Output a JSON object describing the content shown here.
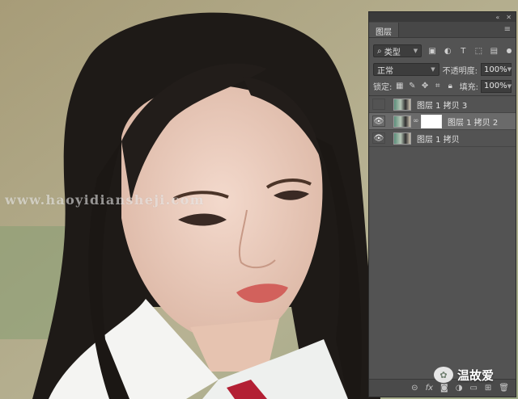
{
  "watermark": "www.haoyidiansheji.com",
  "panel": {
    "tab_label": "图层",
    "filter_kind": "类型",
    "blend_mode": "正常",
    "opacity_label": "不透明度:",
    "opacity_value": "100%",
    "lock_label": "锁定:",
    "fill_label": "填充:",
    "fill_value": "100%",
    "layers": [
      {
        "name": "图层 1 拷贝 3",
        "visible": false,
        "selected": false,
        "has_mask": false
      },
      {
        "name": "图层 1 拷贝 2",
        "visible": true,
        "selected": true,
        "has_mask": true
      },
      {
        "name": "图层 1 拷贝",
        "visible": true,
        "selected": false,
        "has_mask": false
      }
    ],
    "bottom_icons": [
      "link-layers-icon",
      "fx-icon",
      "add-mask-icon",
      "adjustment-icon",
      "group-icon",
      "new-layer-icon",
      "trash-icon"
    ]
  },
  "badge": {
    "text": "温故爱"
  }
}
